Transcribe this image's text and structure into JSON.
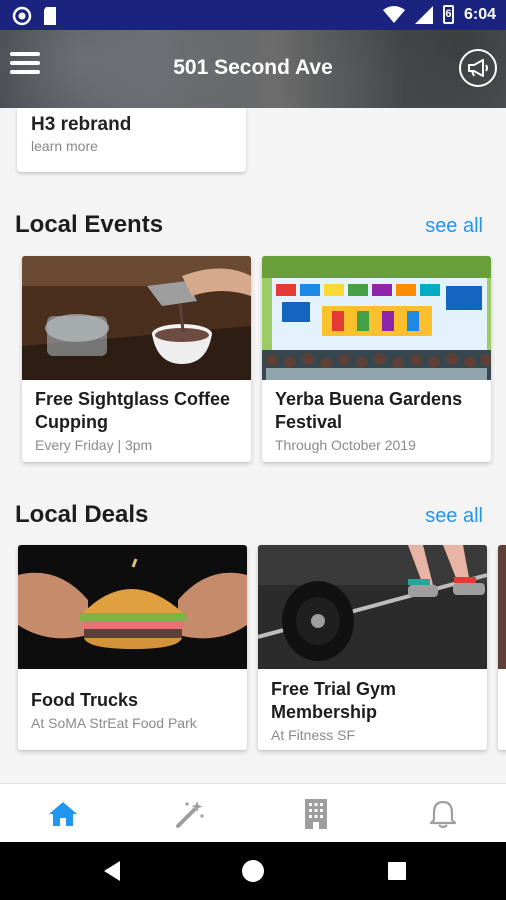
{
  "status_bar": {
    "time": "6:04",
    "battery": "6"
  },
  "app_bar": {
    "title": "501 Second Ave"
  },
  "promo_card": {
    "title": "H3 rebrand",
    "subtitle": "learn more"
  },
  "events": {
    "heading": "Local Events",
    "see_all": "see all",
    "items": [
      {
        "title_line1": "Free Sightglass Coffee",
        "title_line2": "Cupping",
        "subtitle": "Every Friday | 3pm"
      },
      {
        "title_line1": "Yerba Buena Gardens",
        "title_line2": "Festival",
        "subtitle": "Through October 2019"
      }
    ]
  },
  "deals": {
    "heading": "Local Deals",
    "see_all": "see all",
    "items": [
      {
        "title_line1": "Food Trucks",
        "title_line2": "",
        "subtitle": "At SoMA StrEat Food Park"
      },
      {
        "title_line1": "Free Trial Gym",
        "title_line2": "Membership",
        "subtitle": "At Fitness SF"
      }
    ]
  },
  "bottom_nav": {
    "items": [
      "home-icon",
      "magic-wand-icon",
      "building-icon",
      "bell-icon"
    ],
    "active": 0,
    "active_color": "#2196f3",
    "inactive_color": "#9e9e9e"
  },
  "colors": {
    "status_bar": "#1a237e",
    "accent": "#2196f3"
  }
}
